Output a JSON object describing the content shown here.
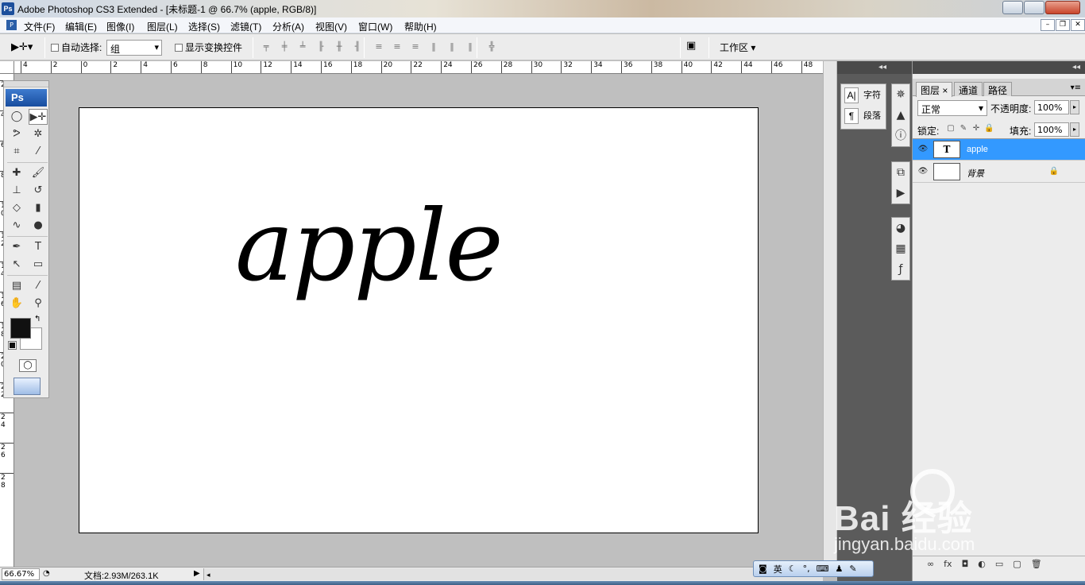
{
  "titlebar": {
    "app_logo": "Ps",
    "title": "Adobe Photoshop CS3 Extended - [未标题-1 @ 66.7% (apple, RGB/8)]"
  },
  "menubar": {
    "items": [
      "文件(F)",
      "编辑(E)",
      "图像(I)",
      "图层(L)",
      "选择(S)",
      "滤镜(T)",
      "分析(A)",
      "视图(V)",
      "窗口(W)",
      "帮助(H)"
    ]
  },
  "options": {
    "auto_select_label": "自动选择:",
    "auto_select_value": "组",
    "show_transform_label": "显示变换控件",
    "workspace_label": "工作区 ▾"
  },
  "hruler_ticks": [
    "4",
    "2",
    "0",
    "2",
    "4",
    "6",
    "8",
    "10",
    "12",
    "14",
    "16",
    "18",
    "20",
    "22",
    "24",
    "26",
    "28",
    "30",
    "32",
    "34",
    "36",
    "38",
    "40",
    "42",
    "44",
    "46",
    "48"
  ],
  "vruler_ticks": [
    "2",
    "4",
    "6",
    "8",
    "1\n0",
    "1\n2",
    "1\n4",
    "1\n6",
    "1\n8",
    "2\n0",
    "2\n2",
    "2\n4",
    "2\n6",
    "2\n8"
  ],
  "toolbox": {
    "logo": "Ps",
    "tools": [
      {
        "name": "marquee-tool-icon",
        "glyph": "◯"
      },
      {
        "name": "move-tool-icon",
        "glyph": "▶✛"
      },
      {
        "name": "lasso-tool-icon",
        "glyph": "ᕗ"
      },
      {
        "name": "magic-wand-tool-icon",
        "glyph": "✲"
      },
      {
        "name": "crop-tool-icon",
        "glyph": "⌗"
      },
      {
        "name": "slice-tool-icon",
        "glyph": "⁄"
      },
      {
        "name": "healing-brush-tool-icon",
        "glyph": "✚"
      },
      {
        "name": "brush-tool-icon",
        "glyph": "🖌"
      },
      {
        "name": "clone-stamp-tool-icon",
        "glyph": "⊥"
      },
      {
        "name": "history-brush-tool-icon",
        "glyph": "↺"
      },
      {
        "name": "eraser-tool-icon",
        "glyph": "◇"
      },
      {
        "name": "gradient-tool-icon",
        "glyph": "▮"
      },
      {
        "name": "blur-tool-icon",
        "glyph": "∿"
      },
      {
        "name": "dodge-tool-icon",
        "glyph": "●"
      },
      {
        "name": "pen-tool-icon",
        "glyph": "✒"
      },
      {
        "name": "type-tool-icon",
        "glyph": "T"
      },
      {
        "name": "path-selection-tool-icon",
        "glyph": "↖"
      },
      {
        "name": "shape-tool-icon",
        "glyph": "▭"
      },
      {
        "name": "notes-tool-icon",
        "glyph": "▤"
      },
      {
        "name": "eyedropper-tool-icon",
        "glyph": "⁄"
      },
      {
        "name": "hand-tool-icon",
        "glyph": "✋"
      },
      {
        "name": "zoom-tool-icon",
        "glyph": "⚲"
      }
    ],
    "foreground_color": "#111111",
    "background_color": "#ffffff"
  },
  "canvas": {
    "text": "apple"
  },
  "dockA": {
    "items": [
      {
        "icon": "A|",
        "label": "字符"
      },
      {
        "icon": "¶",
        "label": "段落"
      }
    ]
  },
  "layers_panel": {
    "tabs": [
      "图层 ×",
      "通道",
      "路径"
    ],
    "blend_mode": "正常",
    "opacity_label": "不透明度:",
    "opacity_value": "100%",
    "lock_label": "锁定:",
    "fill_label": "填充:",
    "fill_value": "100%",
    "layers": [
      {
        "thumb": "T",
        "name": "apple",
        "selected": true
      },
      {
        "thumb": "",
        "name": "背景",
        "selected": false
      }
    ],
    "footer_icons": [
      "∞",
      "fx",
      "◘",
      "◐",
      "▭",
      "▢",
      "🗑"
    ]
  },
  "statusbar": {
    "zoom": "66.67%",
    "doc_info": "文档:2.93M/263.1K"
  },
  "ime": {
    "lang": "英"
  },
  "watermark": {
    "main": "Bai  经验",
    "sub": "jingyan.baidu.com"
  },
  "colors": {
    "selection_blue": "#3399ff",
    "workspace_gray": "#bfbfbf",
    "dock_gray": "#5b5b5b"
  }
}
